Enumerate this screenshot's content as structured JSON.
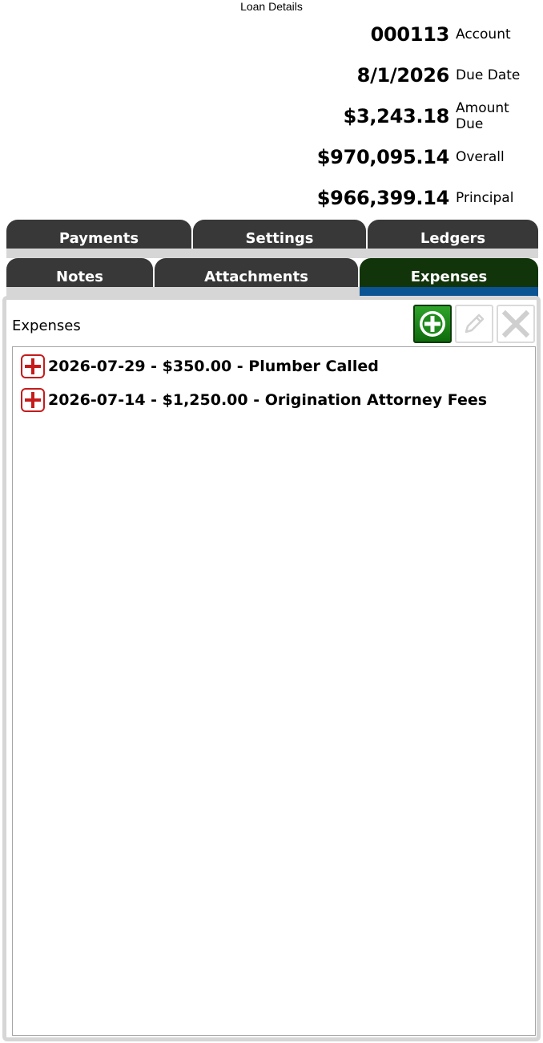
{
  "window": {
    "title": "Loan Details"
  },
  "summary": [
    {
      "value": "000113",
      "label": "Account"
    },
    {
      "value": "8/1/2026",
      "label": "Due Date"
    },
    {
      "value": "$3,243.18",
      "label": "Amount Due"
    },
    {
      "value": "$970,095.14",
      "label": "Overall"
    },
    {
      "value": "$966,399.14",
      "label": "Principal"
    }
  ],
  "tabs_row1": [
    {
      "label": "Payments"
    },
    {
      "label": "Settings"
    },
    {
      "label": "Ledgers"
    }
  ],
  "tabs_row2": [
    {
      "label": "Notes"
    },
    {
      "label": "Attachments"
    },
    {
      "label": "Expenses",
      "active": true
    }
  ],
  "panel": {
    "title": "Expenses",
    "toolbar": [
      {
        "icon": "add-circle-icon",
        "enabled": true
      },
      {
        "icon": "pencil-icon",
        "enabled": false
      },
      {
        "icon": "close-icon",
        "enabled": false
      }
    ],
    "items": [
      {
        "text": "2026-07-29 - $350.00 - Plumber Called",
        "icon": "expand-plus-icon"
      },
      {
        "text": "2026-07-14 - $1,250.00 - Origination Attorney Fees",
        "icon": "expand-plus-icon"
      }
    ]
  },
  "colors": {
    "tab": "#383838",
    "tab_active": "#12340a",
    "tab_active_underline": "#0b5494",
    "add_button": "#1e8a1a",
    "expand_icon": "#c61b1b",
    "panel_border": "#d6d6d6"
  }
}
